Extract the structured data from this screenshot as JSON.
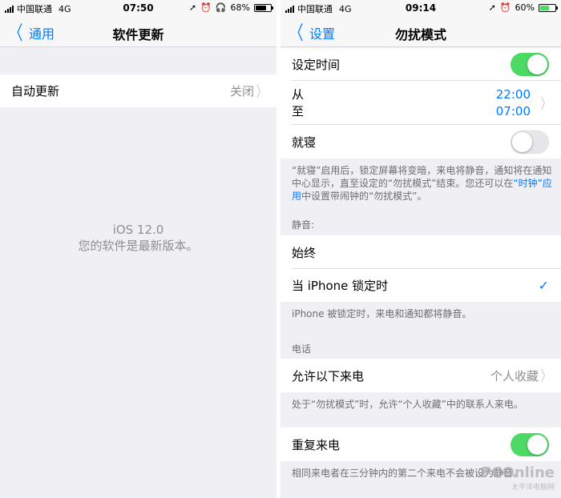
{
  "left": {
    "status": {
      "carrier": "中国联通",
      "network": "4G",
      "time": "07:50",
      "battery": "68%"
    },
    "nav": {
      "back_label": "通用",
      "title": "软件更新"
    },
    "auto_update": {
      "label": "自动更新",
      "value": "关闭"
    },
    "info": {
      "version": "iOS 12.0",
      "message": "您的软件是最新版本。"
    }
  },
  "right": {
    "status": {
      "carrier": "中国联通",
      "network": "4G",
      "time": "09:14",
      "battery": "60%"
    },
    "nav": {
      "back_label": "设置",
      "title": "勿扰模式"
    },
    "scheduled": {
      "label": "设定时间",
      "on": true
    },
    "schedule": {
      "from_label": "从",
      "to_label": "至",
      "from_time": "22:00",
      "to_time": "07:00"
    },
    "bedtime": {
      "label": "就寝",
      "on": false
    },
    "bedtime_footer": {
      "part1": "“就寝”启用后，锁定屏幕将变暗，来电将静音，通知将在通知中心显示，直至设定的“勿扰模式”结束。您还可以在",
      "link": "“时钟”应用",
      "part2": "中设置带闹钟的“勿扰模式”。"
    },
    "silence_header": "静音:",
    "silence_options": [
      {
        "label": "始终",
        "selected": false
      },
      {
        "label": "当 iPhone 锁定时",
        "selected": true
      }
    ],
    "silence_footer": "iPhone 被锁定时，来电和通知都将静音。",
    "phone_header": "电话",
    "allow_calls": {
      "label": "允许以下来电",
      "value": "个人收藏"
    },
    "allow_footer": "处于“勿扰模式”时，允许“个人收藏”中的联系人来电。",
    "repeated_calls": {
      "label": "重复来电",
      "on": true
    },
    "repeated_footer": "相同来电者在三分钟内的第二个来电不会被设为静音。",
    "watermark": {
      "brand": "PCOnline",
      "sub": "太平洋电脑网"
    }
  },
  "colors": {
    "accent": "#007aff",
    "toggle_on": "#4cd964",
    "background": "#efeff4"
  },
  "icons": [
    "signal-bars-icon",
    "location-arrow-icon",
    "alarm-icon",
    "headphones-icon",
    "battery-icon",
    "chevron-left-icon",
    "chevron-right-icon",
    "checkmark-icon"
  ]
}
